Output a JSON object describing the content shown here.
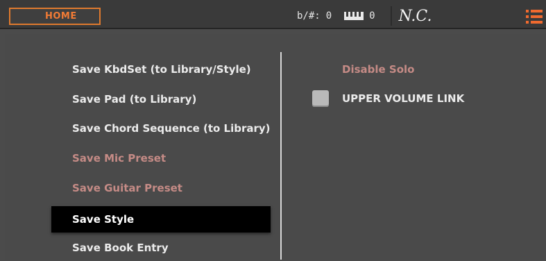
{
  "topbar": {
    "home_tab": "HOME",
    "transpose_label": "b/#:",
    "transpose_value": "0",
    "octave_value": "0",
    "chord": "N.C.",
    "menu_icon": "list-menu-icon",
    "accent_color": "#f27b35"
  },
  "left_menu": {
    "items": [
      {
        "label": "Save KbdSet (to Library/Style)",
        "state": "enabled"
      },
      {
        "label": "Save Pad (to Library)",
        "state": "enabled"
      },
      {
        "label": "Save Chord Sequence (to Library)",
        "state": "enabled"
      },
      {
        "label": "Save Mic Preset",
        "state": "disabled"
      },
      {
        "label": "Save Guitar Preset",
        "state": "disabled"
      },
      {
        "label": "Save Style",
        "state": "selected"
      },
      {
        "label": "Save Book Entry",
        "state": "enabled"
      }
    ]
  },
  "right_panel": {
    "disable_solo": "Disable Solo",
    "upper_volume_link": "UPPER VOLUME LINK",
    "upper_volume_link_checked": false
  }
}
